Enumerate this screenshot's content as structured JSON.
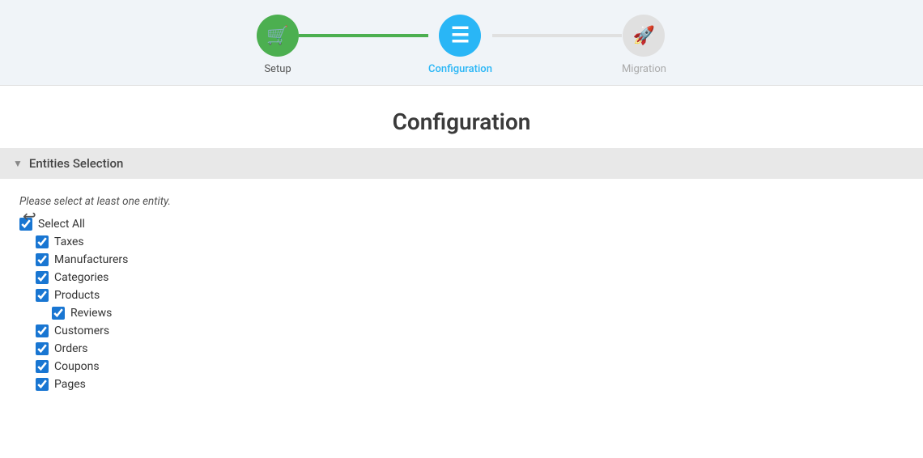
{
  "stepper": {
    "steps": [
      {
        "id": "setup",
        "label": "Setup",
        "icon": "🛒",
        "state": "completed"
      },
      {
        "id": "configuration",
        "label": "Configuration",
        "icon": "≡",
        "state": "active"
      },
      {
        "id": "migration",
        "label": "Migration",
        "icon": "🚀",
        "state": "inactive"
      }
    ],
    "connectors": [
      {
        "id": "c1",
        "state": "completed"
      },
      {
        "id": "c2",
        "state": "inactive"
      }
    ]
  },
  "page": {
    "title": "Configuration",
    "back_label": "←"
  },
  "entities_section": {
    "title": "Entities Selection",
    "hint": "Please select at least one entity.",
    "items": [
      {
        "id": "select-all",
        "label": "Select All",
        "checked": true,
        "indent": 0
      },
      {
        "id": "taxes",
        "label": "Taxes",
        "checked": true,
        "indent": 1
      },
      {
        "id": "manufacturers",
        "label": "Manufacturers",
        "checked": true,
        "indent": 1
      },
      {
        "id": "categories",
        "label": "Categories",
        "checked": true,
        "indent": 1
      },
      {
        "id": "products",
        "label": "Products",
        "checked": true,
        "indent": 1
      },
      {
        "id": "reviews",
        "label": "Reviews",
        "checked": true,
        "indent": 2
      },
      {
        "id": "customers",
        "label": "Customers",
        "checked": true,
        "indent": 1
      },
      {
        "id": "orders",
        "label": "Orders",
        "checked": true,
        "indent": 1
      },
      {
        "id": "coupons",
        "label": "Coupons",
        "checked": true,
        "indent": 1
      },
      {
        "id": "pages",
        "label": "Pages",
        "checked": true,
        "indent": 1
      }
    ]
  },
  "colors": {
    "completed": "#4caf50",
    "active": "#29b6f6",
    "inactive": "#e0e0e0",
    "checkbox_blue": "#1976d2"
  }
}
